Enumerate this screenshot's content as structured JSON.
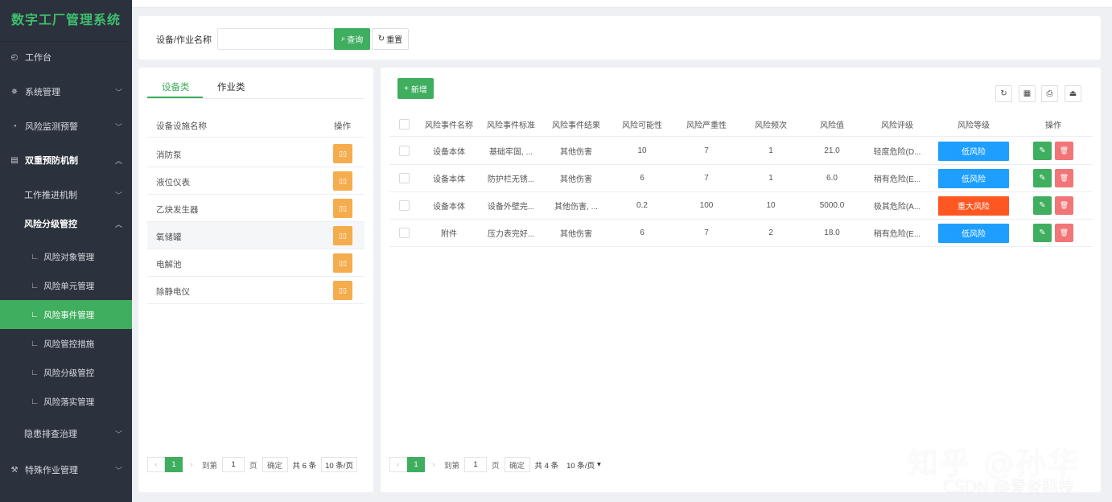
{
  "app": {
    "title": "数字工厂管理系统"
  },
  "sidebar": {
    "items": [
      {
        "label": "工作台",
        "icon": "dashboard-icon"
      },
      {
        "label": "系统管理",
        "icon": "gear-icon"
      },
      {
        "label": "风险监测预警",
        "icon": "alert-icon"
      },
      {
        "label": "双重预防机制",
        "icon": "folder-icon"
      },
      {
        "label": "工作推进机制"
      },
      {
        "label": "风险分级管控"
      },
      {
        "label": "风险对象管理"
      },
      {
        "label": "风险单元管理"
      },
      {
        "label": "风险事件管理"
      },
      {
        "label": "风险管控措施"
      },
      {
        "label": "风险分级管控"
      },
      {
        "label": "风险落实管理"
      },
      {
        "label": "隐患排查治理"
      },
      {
        "label": "特殊作业管理",
        "icon": "tool-icon"
      }
    ]
  },
  "search": {
    "label": "设备/作业名称",
    "value": "",
    "query_label": "查询",
    "reset_label": "重置"
  },
  "left_panel": {
    "tabs": [
      "设备类",
      "作业类"
    ],
    "col_name": "设备设施名称",
    "col_action": "操作",
    "rows": [
      {
        "name": "消防泵"
      },
      {
        "name": "液位仪表"
      },
      {
        "name": "乙炔发生器"
      },
      {
        "name": "氧储罐"
      },
      {
        "name": "电解池"
      },
      {
        "name": "除静电仪"
      }
    ],
    "pager": {
      "current": "1",
      "goto_prefix": "到第",
      "goto_value": "1",
      "goto_suffix": "页",
      "confirm": "确定",
      "total": "共 6 条",
      "size": "10 条/页"
    }
  },
  "right_panel": {
    "add_label": "新增",
    "columns": [
      "风险事件名称",
      "风险事件标准",
      "风险事件结果",
      "风险可能性",
      "风险严重性",
      "风险频次",
      "风险值",
      "风险评级",
      "风险等级",
      "操作"
    ],
    "rows": [
      {
        "name": "设备本体",
        "standard": "基础牢固, ...",
        "result": "其他伤害",
        "likelihood": "10",
        "severity": "7",
        "frequency": "1",
        "value": "21.0",
        "rating": "轻度危险(D...",
        "level": "低风险",
        "level_color": "#1e9fff"
      },
      {
        "name": "设备本体",
        "standard": "防护栏无锈...",
        "result": "其他伤害",
        "likelihood": "6",
        "severity": "7",
        "frequency": "1",
        "value": "6.0",
        "rating": "稍有危险(E...",
        "level": "低风险",
        "level_color": "#1e9fff"
      },
      {
        "name": "设备本体",
        "standard": "设备外壁完...",
        "result": "其他伤害, ...",
        "likelihood": "0.2",
        "severity": "100",
        "frequency": "10",
        "value": "5000.0",
        "rating": "极其危险(A...",
        "level": "重大风险",
        "level_color": "#ff5722"
      },
      {
        "name": "附件",
        "standard": "压力表完好...",
        "result": "其他伤害",
        "likelihood": "6",
        "severity": "7",
        "frequency": "2",
        "value": "18.0",
        "rating": "稍有危险(E...",
        "level": "低风险",
        "level_color": "#1e9fff"
      }
    ],
    "pager": {
      "current": "1",
      "goto_prefix": "到第",
      "goto_value": "1",
      "goto_suffix": "页",
      "confirm": "确定",
      "total": "共 4 条",
      "size": "10 条/页"
    }
  },
  "watermark": {
    "line1": "知乎 @孙华",
    "line2": "CSDN @爱炎科技"
  },
  "colors": {
    "primary": "#3fae5e",
    "sidebar_bg": "#2c323d",
    "warning": "#f5ac4c",
    "danger": "#f27578"
  }
}
